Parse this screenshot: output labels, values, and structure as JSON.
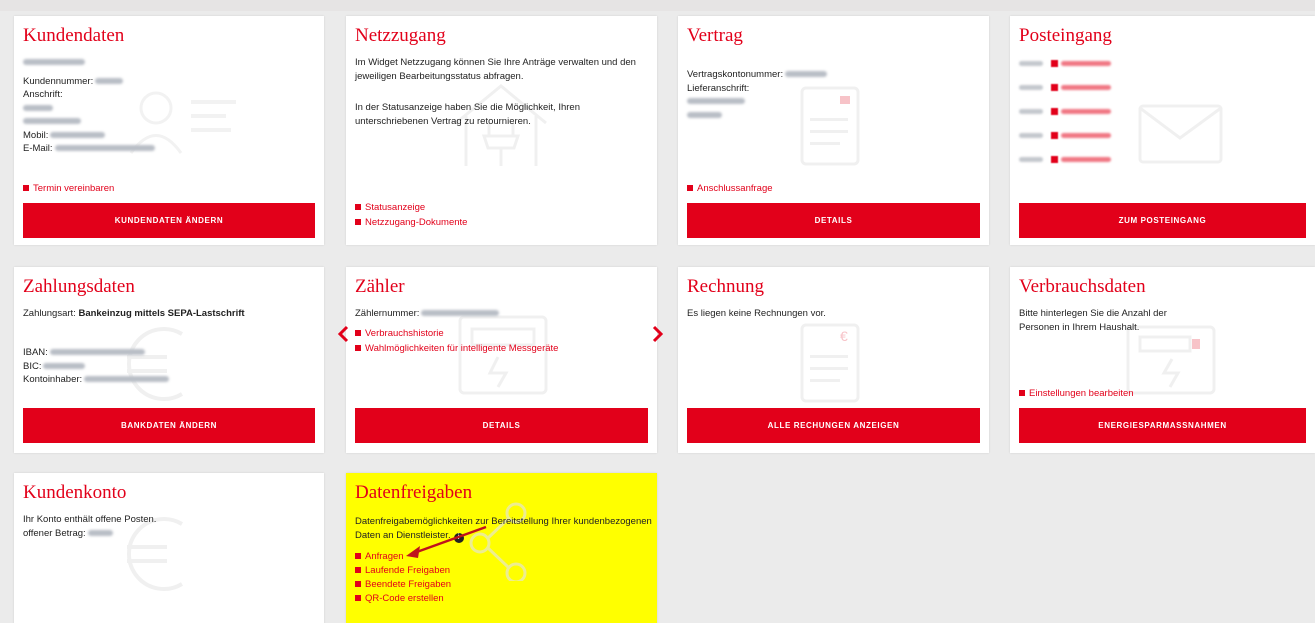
{
  "colors": {
    "accent": "#e2001a",
    "highlight": "#ffff00",
    "background": "#ebebeb"
  },
  "kundendaten": {
    "title": "Kundendaten",
    "kundennummer_label": "Kundennummer:",
    "anschrift_label": "Anschrift:",
    "mobil_label": "Mobil:",
    "email_label": "E-Mail:",
    "link": "Termin vereinbaren",
    "button": "KUNDENDATEN ÄNDERN",
    "icon": "user-card-icon"
  },
  "netzzugang": {
    "title": "Netzzugang",
    "text1": "Im Widget Netzzugang können Sie Ihre Anträge verwalten und den jeweiligen Bearbeitungsstatus abfragen.",
    "text2": "In der Statusanzeige haben Sie die Möglichkeit, Ihren unterschriebenen Vertrag zu retournieren.",
    "links": [
      "Statusanzeige",
      "Netzzugang-Dokumente"
    ],
    "icon": "house-plug-icon"
  },
  "vertrag": {
    "title": "Vertrag",
    "konto_label": "Vertragskontonummer:",
    "liefer_label": "Lieferanschrift:",
    "link": "Anschlussanfrage",
    "button": "DETAILS",
    "icon": "document-icon"
  },
  "posteingang": {
    "title": "Posteingang",
    "button": "ZUM POSTEINGANG",
    "icon": "envelope-icon"
  },
  "zahlungsdaten": {
    "title": "Zahlungsdaten",
    "zahlungsart_label": "Zahlungsart:",
    "zahlungsart_value": "Bankeinzug mittels SEPA-Lastschrift",
    "iban_label": "IBAN:",
    "bic_label": "BIC:",
    "kontoinhaber_label": "Kontoinhaber:",
    "button": "BANKDATEN ÄNDERN",
    "icon": "euro-icon"
  },
  "zaehler": {
    "title": "Zähler",
    "nummer_label": "Zählernummer:",
    "links": [
      "Verbrauchshistorie",
      "Wahlmöglichkeiten für intelligente Messgeräte"
    ],
    "button": "DETAILS",
    "icon": "meter-icon"
  },
  "rechnung": {
    "title": "Rechnung",
    "text": "Es liegen keine Rechnungen vor.",
    "button": "ALLE RECHUNGEN ANZEIGEN",
    "icon": "invoice-icon"
  },
  "verbrauchsdaten": {
    "title": "Verbrauchsdaten",
    "text": "Bitte hinterlegen Sie die Anzahl der Personen in Ihrem Haushalt.",
    "link": "Einstellungen bearbeiten",
    "button": "ENERGIESPARMASSNAHMEN",
    "icon": "meter-plug-icon"
  },
  "kundenkonto": {
    "title": "Kundenkonto",
    "text": "Ihr Konto enthält offene Posten.",
    "betrag_label": "offener Betrag:",
    "icon": "euro-icon"
  },
  "datenfreigaben": {
    "title": "Datenfreigaben",
    "text": "Datenfreigabemöglichkeiten zur Bereitstellung Ihrer kundenbezogenen Daten an Dienstleister.",
    "info": "i",
    "links": [
      "Anfragen",
      "Laufende Freigaben",
      "Beendete Freigaben",
      "QR-Code erstellen"
    ],
    "icon": "share-icon"
  }
}
